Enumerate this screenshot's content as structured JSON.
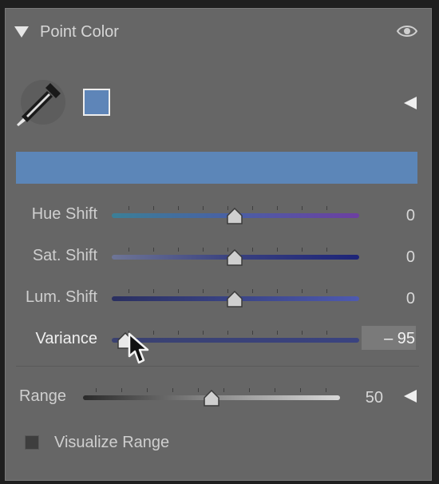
{
  "header": {
    "title": "Point Color",
    "eye_icon": "eye-icon",
    "collapse_icon": "triangle-down-icon"
  },
  "picker": {
    "dropper_icon": "eyedropper-icon",
    "swatch_color": "#5e85b8",
    "expand_icon": "triangle-left-icon"
  },
  "color_bar": {
    "color": "#5c86b8"
  },
  "sliders": [
    {
      "label": "Hue Shift",
      "value": "0",
      "position": 0.5
    },
    {
      "label": "Sat. Shift",
      "value": "0",
      "position": 0.5
    },
    {
      "label": "Lum. Shift",
      "value": "0",
      "position": 0.5
    },
    {
      "label": "Variance",
      "value": "– 95",
      "position": 0.03
    }
  ],
  "range": {
    "label": "Range",
    "value": "50",
    "position": 0.5,
    "arrow_icon": "triangle-left-icon"
  },
  "visualize": {
    "label": "Visualize Range",
    "checked": false
  },
  "cursor": {
    "icon": "mouse-pointer-icon"
  }
}
